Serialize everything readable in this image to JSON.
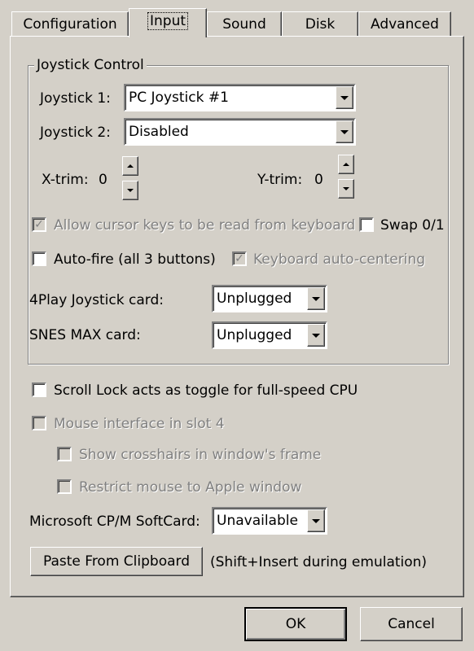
{
  "tabs": [
    {
      "label": "Configuration",
      "active": false
    },
    {
      "label": "Input",
      "active": true
    },
    {
      "label": "Sound",
      "active": false
    },
    {
      "label": "Disk",
      "active": false
    },
    {
      "label": "Advanced",
      "active": false
    }
  ],
  "joystick_group": {
    "title": "Joystick Control",
    "joystick1_label": "Joystick 1:",
    "joystick1_value": "PC Joystick #1",
    "joystick2_label": "Joystick 2:",
    "joystick2_value": "Disabled",
    "xtrim_label": "X-trim:",
    "xtrim_value": "0",
    "ytrim_label": "Y-trim:",
    "ytrim_value": "0",
    "allow_cursor_label": "Allow cursor keys to be read from keyboard",
    "allow_cursor_checked": true,
    "swap_label": "Swap 0/1",
    "swap_checked": false,
    "autofire_label": "Auto-fire (all 3 buttons)",
    "autofire_checked": false,
    "kb_autocenter_label": "Keyboard auto-centering",
    "kb_autocenter_checked": true,
    "fourplay_label": "4Play Joystick card:",
    "fourplay_value": "Unplugged",
    "snes_label": "SNES MAX card:",
    "snes_value": "Unplugged"
  },
  "scroll_lock_label": "Scroll Lock acts as toggle for full-speed CPU",
  "mouse_slot4_label": "Mouse interface in slot 4",
  "crosshairs_label": "Show crosshairs in window's frame",
  "restrict_mouse_label": "Restrict mouse to Apple window",
  "cpm_label": "Microsoft CP/M SoftCard:",
  "cpm_value": "Unavailable",
  "paste_button": "Paste From Clipboard",
  "paste_hint": "(Shift+Insert during emulation)",
  "ok_button": "OK",
  "cancel_button": "Cancel",
  "check_glyph": "✓"
}
